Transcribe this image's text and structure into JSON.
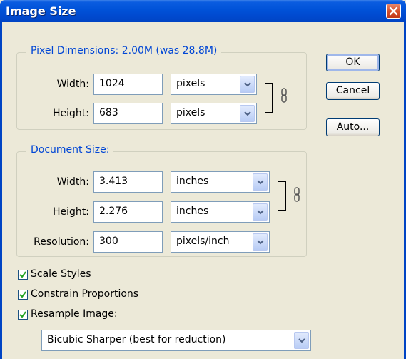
{
  "window": {
    "title": "Image Size"
  },
  "pixel_dimensions": {
    "legend": "Pixel Dimensions:  2.00M (was 28.8M)",
    "width_label": "Width:",
    "width_value": "1024",
    "width_unit": "pixels",
    "height_label": "Height:",
    "height_value": "683",
    "height_unit": "pixels"
  },
  "document_size": {
    "legend": "Document Size:",
    "width_label": "Width:",
    "width_value": "3.413",
    "width_unit": "inches",
    "height_label": "Height:",
    "height_value": "2.276",
    "height_unit": "inches",
    "resolution_label": "Resolution:",
    "resolution_value": "300",
    "resolution_unit": "pixels/inch"
  },
  "buttons": {
    "ok": "OK",
    "cancel": "Cancel",
    "auto": "Auto..."
  },
  "options": {
    "scale_styles": {
      "label": "Scale Styles",
      "checked": true
    },
    "constrain_proportions": {
      "label": "Constrain Proportions",
      "checked": true
    },
    "resample_image": {
      "label": "Resample Image:",
      "checked": true
    }
  },
  "resample_method": {
    "value": "Bicubic Sharper (best for reduction)"
  },
  "icons": {
    "close": "close-icon",
    "link": "chain-link-icon",
    "dropdown": "chevron-down-icon",
    "check": "checkmark-icon"
  },
  "colors": {
    "title_bar": "#0052d8",
    "legend_text": "#0046d5",
    "dialog_bg": "#ece9d8",
    "close_button": "#d6502c"
  }
}
